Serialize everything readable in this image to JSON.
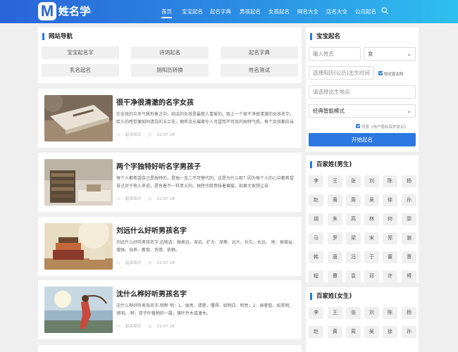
{
  "header": {
    "logo_mark": "M",
    "logo_text": "姓名学",
    "logo_top": "免费",
    "logo_sub": "起名",
    "nav": [
      "首页",
      "宝宝起名",
      "起名字典",
      "男孩起名",
      "女孩起名",
      "网名大全",
      "店名大全",
      "公司起名"
    ],
    "active_index": 0
  },
  "site_nav": {
    "title": "网站导航",
    "links": [
      "宝宝起名字",
      "诗词起名",
      "起名字典",
      "乳名起名",
      "阴阳历转换",
      "姓名测试"
    ]
  },
  "articles": [
    {
      "title": "很干净很清澈的名字女孩",
      "desc": "在女孩的众多气质形象之中，纯洁的女孩是最惹人喜爱的。取上一个很干净很清澈的女孩名字，给人的感觉便如同清白的玉兰花，拥有流光璀璨令人可望而不可及的独特气质。每个女孩都应当",
      "author": "起名知识",
      "date": "22-07-28"
    },
    {
      "title": "两个字独特好听名字男孩子",
      "desc": "每个人都希望自己是独特的，是独一无二不可替代的。这是为什么呢？因为每个人的心中都希望自己对于他人来说，是有着不一样意义的。独特也就意味着偏爱。如果大家想让自",
      "author": "起名知识",
      "date": "22-07-28"
    },
    {
      "title": "刘远什么好听男孩名字",
      "desc": "刘远什么好听男孩名字,远啥选：振高远、深远、扩大、深奥、远大、长久、长远。 啥：振增益、增强、培养、教育、凭借、依赖。",
      "author": "起名知识",
      "date": "22-07-28"
    },
    {
      "title": "沈什么桦好听男孩名字",
      "desc": "沈什么桦好听男孩名字,明桦 明：1、振亮、清楚、懂得、如明白、明亮；2、振睿智、如英明、贤明。 桦：双子叶植物的一属，落叶乔木或灌木。",
      "author": "起名知识",
      "date": "22-07-28"
    }
  ],
  "baby_form": {
    "title": "宝宝起名",
    "surname_placeholder": "输入姓氏",
    "gender_value": "女",
    "birth_placeholder": "选择阳历(公历)出生时间",
    "solar_label": "较对真太阳",
    "place_placeholder": "请选择出生地点",
    "mode_value": "经典智能模式",
    "agree_label": "同意《用户隐私保护协议》",
    "submit_label": "开始起名"
  },
  "surnames_male": {
    "title": "百家姓(男生)",
    "names": [
      "李",
      "王",
      "张",
      "刘",
      "陈",
      "杨",
      "赵",
      "黄",
      "周",
      "吴",
      "徐",
      "孙",
      "胡",
      "朱",
      "高",
      "林",
      "何",
      "郭",
      "马",
      "罗",
      "梁",
      "宋",
      "郑",
      "谢",
      "韩",
      "唐",
      "冯",
      "于",
      "董",
      "萧",
      "程",
      "曹",
      "袁",
      "邓",
      "许",
      "傅"
    ]
  },
  "surnames_female": {
    "title": "百家姓(女生)",
    "names": [
      "李",
      "王",
      "张",
      "刘",
      "陈",
      "杨",
      "赵",
      "黄",
      "周",
      "吴",
      "徐",
      "孙"
    ]
  },
  "colors": {
    "accent": "#2a78e0",
    "header_start": "#2a64d8",
    "header_end": "#2fc0ef"
  }
}
